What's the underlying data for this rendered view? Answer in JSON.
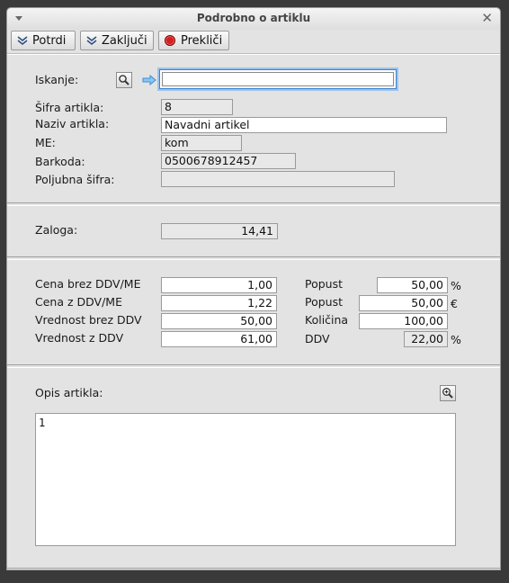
{
  "window": {
    "title": "Podrobno o artiklu"
  },
  "toolbar": {
    "confirm": "Potrdi",
    "close": "Zaključi",
    "cancel": "Prekliči"
  },
  "search": {
    "label": "Iskanje:",
    "value": ""
  },
  "article": {
    "code_label": "Šifra artikla:",
    "code": "8",
    "name_label": "Naziv artikla:",
    "name": "Navadni artikel",
    "unit_label": "ME:",
    "unit": "kom",
    "barcode_label": "Barkoda:",
    "barcode": "0500678912457",
    "custom_label": "Poljubna šifra:",
    "custom": ""
  },
  "stock": {
    "label": "Zaloga:",
    "value": "14,41"
  },
  "pricing": {
    "price_net_label": "Cena brez DDV/ME",
    "price_net": "1,00",
    "price_gross_label": "Cena z DDV/ME",
    "price_gross": "1,22",
    "value_net_label": "Vrednost brez DDV",
    "value_net": "50,00",
    "value_gross_label": "Vrednost z DDV",
    "value_gross": "61,00",
    "discount_pct_label": "Popust",
    "discount_pct": "50,00",
    "discount_pct_unit": "%",
    "discount_eur_label": "Popust",
    "discount_eur": "50,00",
    "discount_eur_unit": "€",
    "quantity_label": "Količina",
    "quantity": "100,00",
    "vat_label": "DDV",
    "vat": "22,00",
    "vat_unit": "%"
  },
  "description": {
    "label": "Opis artikla:",
    "text": "1"
  },
  "colors": {
    "focus": "#3d82c9",
    "cancel_icon": "#d32020",
    "arrow": "#3a8fd8"
  },
  "icons": [
    "menu-arrow-icon",
    "close-icon",
    "chevron-down-icon",
    "stop-icon",
    "magnifier-icon",
    "arrow-right-icon",
    "zoom-plus-icon"
  ]
}
